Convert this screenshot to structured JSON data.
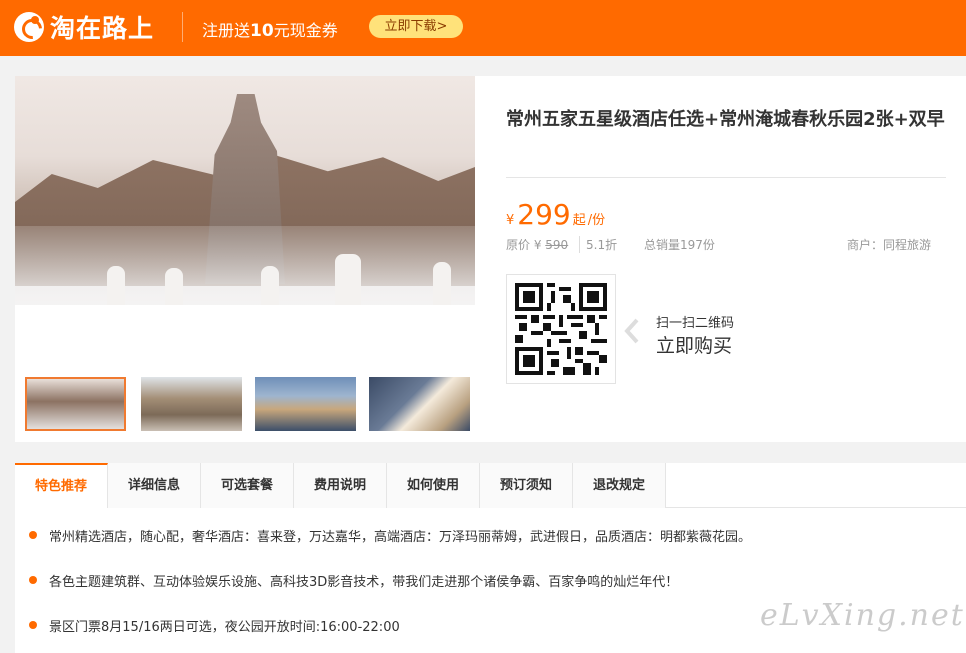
{
  "header": {
    "logo_text": "淘在路上",
    "promo_prefix": "注册送",
    "promo_amount": "10",
    "promo_suffix": "元现金券",
    "download_label": "立即下载>"
  },
  "product": {
    "title": "常州五家五星级酒店任选+常州淹城春秋乐园2张+双早",
    "currency": "¥",
    "price": "299",
    "price_suffix": "起",
    "price_unit": "/份",
    "original_label": "原价 ¥",
    "original_price": "590",
    "discount": "5.1折",
    "sales": "总销量197份",
    "merchant": "商户：同程旅游",
    "thumbnail_count": 4
  },
  "qr": {
    "hint_small": "扫一扫二维码",
    "hint_big": "立即购买"
  },
  "tabs": [
    {
      "label": "特色推荐",
      "active": true
    },
    {
      "label": "详细信息",
      "active": false
    },
    {
      "label": "可选套餐",
      "active": false
    },
    {
      "label": "费用说明",
      "active": false
    },
    {
      "label": "如何使用",
      "active": false
    },
    {
      "label": "预订须知",
      "active": false
    },
    {
      "label": "退改规定",
      "active": false
    }
  ],
  "features": [
    "常州精选酒店，随心配，奢华酒店：喜来登，万达嘉华，高端酒店：万泽玛丽蒂姆，武进假日，品质酒店：明都紫薇花园。",
    "各色主题建筑群、互动体验娱乐设施、高科技3D影音技术，带我们走进那个诸侯争霸、百家争鸣的灿烂年代！",
    "景区门票8月15/16两日可选，夜公园开放时间:16:00-22:00"
  ],
  "watermark": "eLvXing.net",
  "colors": {
    "brand": "#ff6a00",
    "button": "#ffe27a"
  }
}
